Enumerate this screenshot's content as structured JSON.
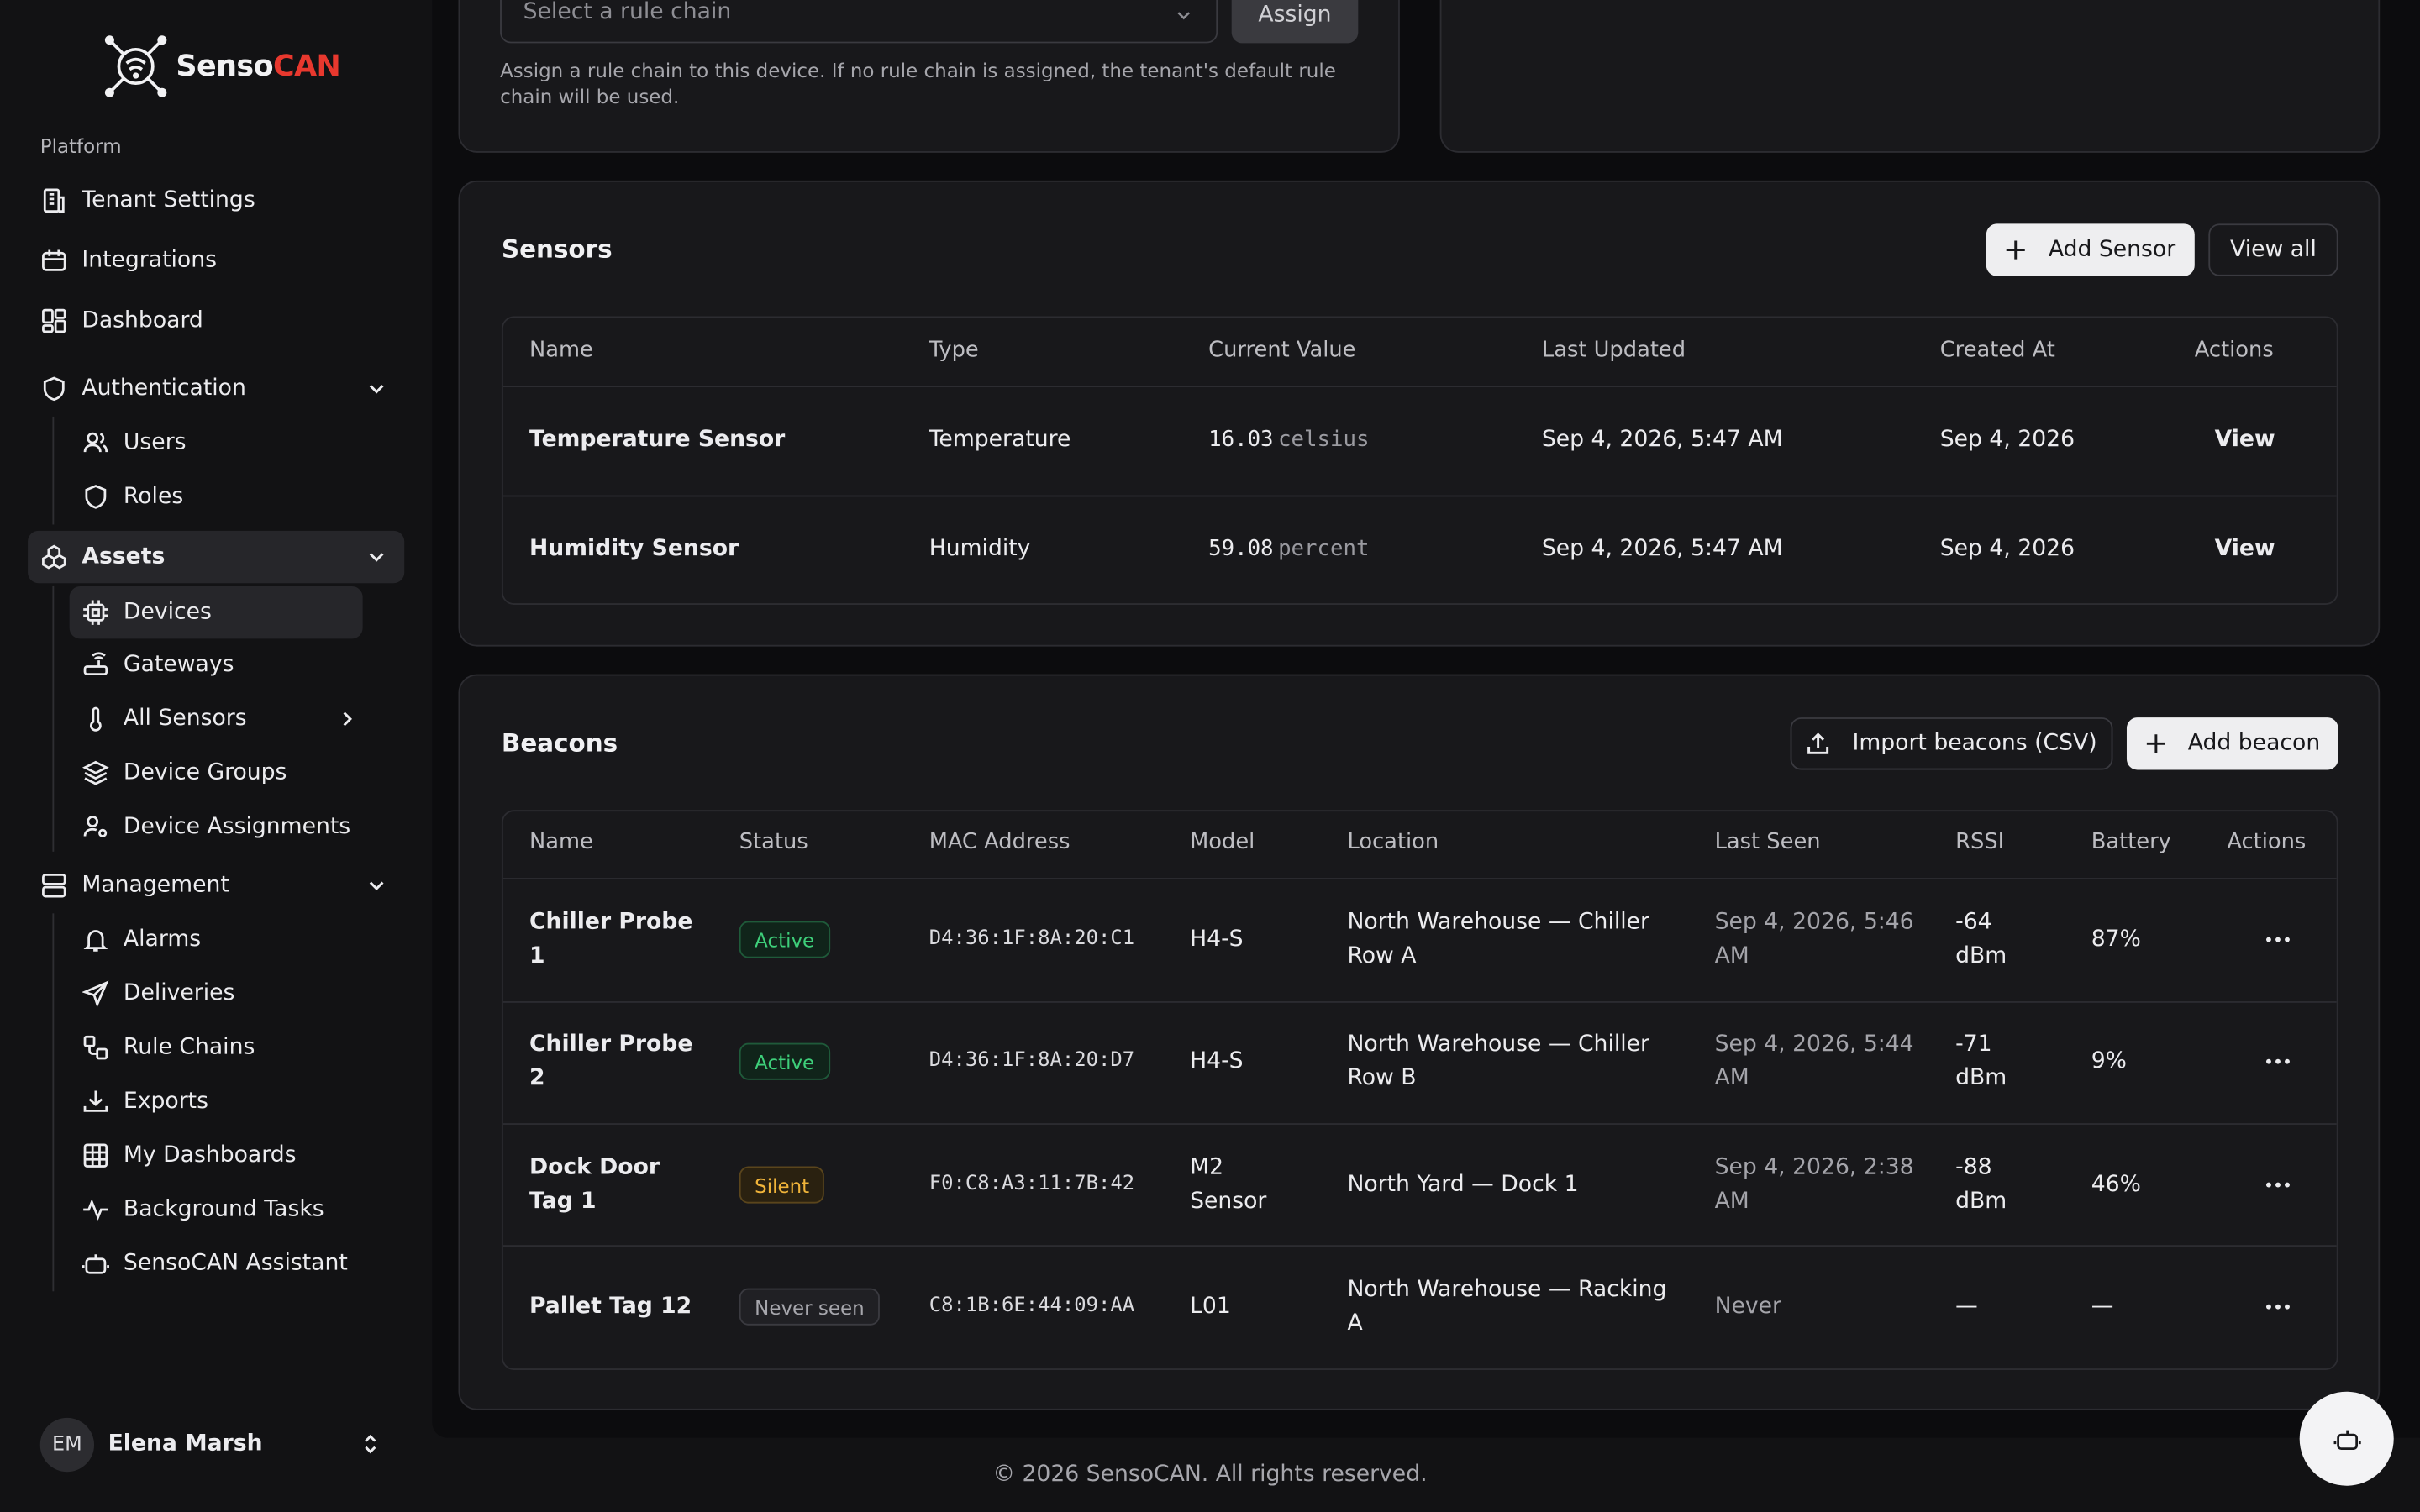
{
  "app": {
    "brand_a": "Senso",
    "brand_b": "CAN"
  },
  "sidebar": {
    "section": "Platform",
    "items": [
      {
        "label": "Tenant Settings"
      },
      {
        "label": "Integrations"
      },
      {
        "label": "Dashboard"
      },
      {
        "label": "Authentication"
      },
      {
        "label": "Users"
      },
      {
        "label": "Roles"
      },
      {
        "label": "Assets"
      },
      {
        "label": "Devices"
      },
      {
        "label": "Gateways"
      },
      {
        "label": "All Sensors"
      },
      {
        "label": "Device Groups"
      },
      {
        "label": "Device Assignments"
      },
      {
        "label": "Management"
      },
      {
        "label": "Alarms"
      },
      {
        "label": "Deliveries"
      },
      {
        "label": "Rule Chains"
      },
      {
        "label": "Exports"
      },
      {
        "label": "My Dashboards"
      },
      {
        "label": "Background Tasks"
      },
      {
        "label": "SensoCAN Assistant"
      }
    ],
    "user": {
      "initials": "EM",
      "name": "Elena Marsh"
    }
  },
  "rule_chain": {
    "placeholder": "Select a rule chain",
    "assign_label": "Assign",
    "help": "Assign a rule chain to this device. If no rule chain is assigned, the tenant's default rule chain will be used."
  },
  "sensors": {
    "title": "Sensors",
    "add_label": "Add Sensor",
    "view_all_label": "View all",
    "columns": [
      "Name",
      "Type",
      "Current Value",
      "Last Updated",
      "Created At",
      "Actions"
    ],
    "rows": [
      {
        "name": "Temperature Sensor",
        "type": "Temperature",
        "value": "16.03",
        "unit": "celsius",
        "updated": "Sep 4, 2026, 5:47 AM",
        "created": "Sep 4, 2026",
        "action": "View"
      },
      {
        "name": "Humidity Sensor",
        "type": "Humidity",
        "value": "59.08",
        "unit": "percent",
        "updated": "Sep 4, 2026, 5:47 AM",
        "created": "Sep 4, 2026",
        "action": "View"
      }
    ]
  },
  "beacons": {
    "title": "Beacons",
    "import_label": "Import beacons (CSV)",
    "add_label": "Add beacon",
    "columns": [
      "Name",
      "Status",
      "MAC Address",
      "Model",
      "Location",
      "Last Seen",
      "RSSI",
      "Battery",
      "Actions"
    ],
    "rows": [
      {
        "name1": "Chiller Probe",
        "name2": "1",
        "status": "Active",
        "mac": "D4:36:1F:8A:20:C1",
        "model1": "H4-S",
        "model2": "",
        "loc1": "North Warehouse — Chiller",
        "loc2": "Row A",
        "seen1": "Sep 4, 2026, 5:46",
        "seen2": "AM",
        "rssi1": "-64",
        "rssi2": "dBm",
        "battery": "87%"
      },
      {
        "name1": "Chiller Probe",
        "name2": "2",
        "status": "Active",
        "mac": "D4:36:1F:8A:20:D7",
        "model1": "H4-S",
        "model2": "",
        "loc1": "North Warehouse — Chiller",
        "loc2": "Row B",
        "seen1": "Sep 4, 2026, 5:44",
        "seen2": "AM",
        "rssi1": "-71",
        "rssi2": "dBm",
        "battery": "9%"
      },
      {
        "name1": "Dock Door",
        "name2": "Tag 1",
        "status": "Silent",
        "mac": "F0:C8:A3:11:7B:42",
        "model1": "M2",
        "model2": "Sensor",
        "loc1": "North Yard — Dock 1",
        "loc2": "",
        "seen1": "Sep 4, 2026, 2:38",
        "seen2": "AM",
        "rssi1": "-88",
        "rssi2": "dBm",
        "battery": "46%"
      },
      {
        "name1": "Pallet Tag 12",
        "name2": "",
        "status": "Never seen",
        "mac": "C8:1B:6E:44:09:AA",
        "model1": "L01",
        "model2": "",
        "loc1": "North Warehouse — Racking",
        "loc2": "A",
        "seen1": "Never",
        "seen2": "",
        "rssi1": "—",
        "rssi2": "",
        "battery": "—"
      }
    ]
  },
  "footer": "© 2026 SensoCAN. All rights reserved.",
  "colors": {
    "accent_red": "#e8382e",
    "active_green": "#3ecf7a",
    "silent_amber": "#f0b43a"
  }
}
